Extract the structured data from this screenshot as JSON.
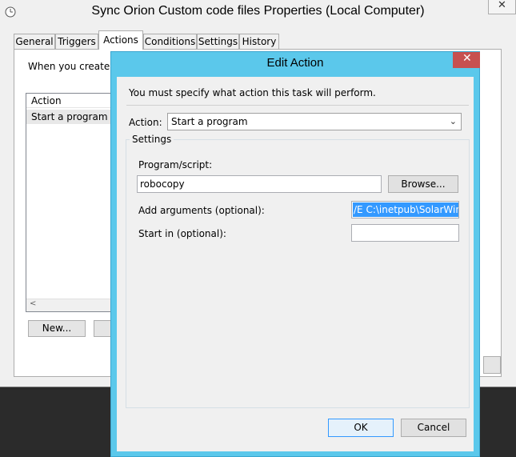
{
  "window": {
    "title": "Sync Orion Custom code files Properties (Local Computer)",
    "close_glyph": "✕"
  },
  "tabs": [
    {
      "label": "General"
    },
    {
      "label": "Triggers"
    },
    {
      "label": "Actions"
    },
    {
      "label": "Conditions"
    },
    {
      "label": "Settings"
    },
    {
      "label": "History"
    }
  ],
  "actions_tab": {
    "hint": "When you create a t",
    "list_header": "Action",
    "rows": [
      {
        "action": "Start a program"
      }
    ],
    "new_button": "New..."
  },
  "dialog": {
    "title": "Edit Action",
    "close_glyph": "✕",
    "prompt": "You must specify what action this task will perform.",
    "action_label": "Action:",
    "action_value": "Start a program",
    "settings_legend": "Settings",
    "program_label": "Program/script:",
    "program_value": "robocopy",
    "browse_button": "Browse...",
    "args_label": "Add arguments (optional):",
    "args_value": "/E C:\\inetpub\\SolarWind",
    "start_in_label": "Start in (optional):",
    "start_in_value": "",
    "ok_button": "OK",
    "cancel_button": "Cancel"
  },
  "colors": {
    "dialog_frame": "#5bc8eb",
    "close_button": "#c75050",
    "selection": "#3399ff"
  }
}
